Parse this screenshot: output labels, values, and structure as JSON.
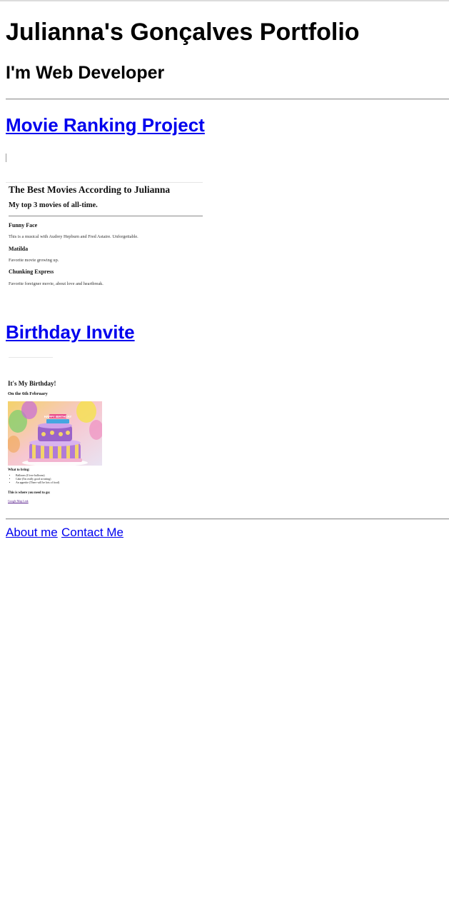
{
  "header": {
    "title": "Julianna's Gonçalves Portfolio",
    "subtitle": "I'm Web Developer"
  },
  "projects": [
    {
      "link_label": "Movie Ranking Project",
      "preview": {
        "heading": "The Best Movies According to Julianna",
        "subheading": "My top 3 movies of all-time.",
        "movies": [
          {
            "title": "Funny Face",
            "description": "This is a musical with Audrey Hepburn and Fred Astaire. Unforgettable."
          },
          {
            "title": "Matilda",
            "description": "Favorite movie growing up."
          },
          {
            "title": "Chunking Express",
            "description": "Favorite foreigner movie, about love and heartbreak."
          }
        ]
      }
    },
    {
      "link_label": "Birthday Invite",
      "preview": {
        "heading": "It's My Birthday!",
        "date": "On the 6th February",
        "bring_heading": "What to bring:",
        "bring_items": [
          "Balloons (I love balloons)",
          "Cake (I'm really good at eating)",
          "An appetite (There will be lots of food)"
        ],
        "location_heading": "This is where you need to go:",
        "map_link": "Google Map Link",
        "cake_topper": "HAPPY BIRTHDAY"
      }
    }
  ],
  "footer_nav": {
    "about": "About me",
    "contact": "Contact Me"
  }
}
